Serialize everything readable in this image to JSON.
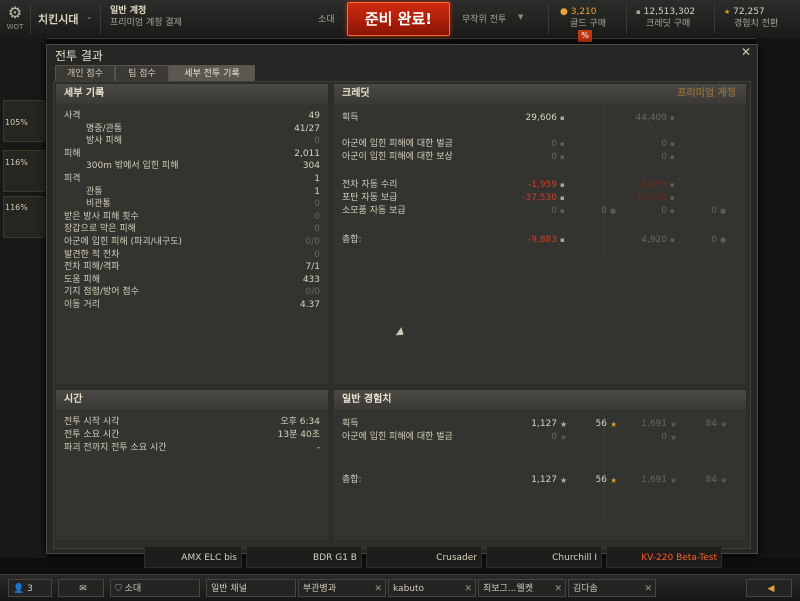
{
  "topbar": {
    "logo_text": "WOT",
    "clan_label": "치킨시대",
    "account_type": "일반 계정",
    "account_sub": "프리미엄 계정 결제",
    "squad_label": "소대",
    "battle_button": "준비 완료!",
    "battle_mode": "무작위 전투",
    "gold_value": "3,210",
    "gold_label": "골드 구매",
    "gold_badge": "%",
    "credits_value": "12,513,302",
    "credits_label": "크레딧 구매",
    "exp_value": "72,257",
    "exp_label": "경험치 전환"
  },
  "side": {
    "c1": "105%",
    "c2": "116%",
    "c3": "116%"
  },
  "window": {
    "title": "전투 결과",
    "close_icon": "close-icon",
    "tabs": [
      "개인 점수",
      "팀 점수",
      "세부 전투 기록"
    ],
    "active_tab": 2
  },
  "details": {
    "header": "세부 기록",
    "rows": [
      {
        "label": "사격",
        "value": "49",
        "dim": false,
        "indent": false
      },
      {
        "label": "명중/관통",
        "value": "41/27",
        "dim": false,
        "indent": true
      },
      {
        "label": "방사 피해",
        "value": "0",
        "dim": true,
        "indent": true
      },
      {
        "label": "피해",
        "value": "2,011",
        "dim": false,
        "indent": false
      },
      {
        "label": "300m 밖에서 입힌 피해",
        "value": "304",
        "dim": false,
        "indent": true
      },
      {
        "label": "피격",
        "value": "1",
        "dim": false,
        "indent": false
      },
      {
        "label": "관통",
        "value": "1",
        "dim": false,
        "indent": true
      },
      {
        "label": "비관통",
        "value": "0",
        "dim": true,
        "indent": true
      },
      {
        "label": "받은 방사 피해 횟수",
        "value": "0",
        "dim": true,
        "indent": false
      },
      {
        "label": "장갑으로 막은 피해",
        "value": "0",
        "dim": true,
        "indent": false
      },
      {
        "label": "아군에 입힌 피해 (파괴/내구도)",
        "value": "0/0",
        "dim": true,
        "indent": false
      },
      {
        "label": "발견한 적 전차",
        "value": "0",
        "dim": true,
        "indent": false
      },
      {
        "label": "전차 피해/격파",
        "value": "7/1",
        "dim": false,
        "indent": false
      },
      {
        "label": "도움 피해",
        "value": "433",
        "dim": false,
        "indent": false
      },
      {
        "label": "기지 점령/방어 점수",
        "value": "0/0",
        "dim": true,
        "indent": false
      },
      {
        "label": "이동 거리",
        "value": "4.37",
        "dim": false,
        "indent": false
      }
    ]
  },
  "credits": {
    "header": "크레딧",
    "premium_header": "프리미엄 계정",
    "earned_label": "획득",
    "earned": "29,606",
    "earned_prem": "44,409",
    "ff_fine_label": "아군에 입힌 피해에 대한 벌금",
    "ff_fine": "0",
    "ff_fine_prem": "0",
    "ff_comp_label": "아군이 입힌 피해에 대한 보상",
    "ff_comp": "0",
    "ff_comp_prem": "0",
    "repair_label": "전차 자동 수리",
    "repair": "-1,959",
    "repair_prem": "-1,959",
    "ammo_label": "포탄 자동 보급",
    "ammo": "-37,530",
    "ammo_prem": "-37,530",
    "consum_label": "소모품 자동 보급",
    "consum": "0",
    "consum_gold": "0",
    "consum_prem": "0",
    "consum_prem_gold": "0",
    "total_label": "총합:",
    "total": "-9,883",
    "total_prem": "4,920",
    "total_prem_gold": "0"
  },
  "time": {
    "header": "시간",
    "rows": [
      {
        "label": "전투 시작 시각",
        "value": "오후 6:34"
      },
      {
        "label": "전투 소요 시간",
        "value": "13분 40초"
      },
      {
        "label": "파괴 전까지 전투 소요 시간",
        "value": "-"
      }
    ]
  },
  "experience": {
    "header": "일반 경험치",
    "earned_label": "획득",
    "earned": "1,127",
    "earned_free": "56",
    "earned_prem": "1,691",
    "earned_prem_free": "84",
    "fine_label": "아군에 입힌 피해에 대한 벌금",
    "fine": "0",
    "fine_prem": "0",
    "total_label": "총합:",
    "total": "1,127",
    "total_free": "56",
    "total_prem": "1,691",
    "total_prem_free": "84"
  },
  "vehicles": [
    "AMX ELC bis",
    "BDR G1 B",
    "Crusader",
    "Churchill I",
    "KV-220 Beta-Test"
  ],
  "bottombar": {
    "friends_count": "3",
    "squad_label": "소대",
    "channels": [
      "일반 채널",
      "부관병과",
      "kabuto",
      "최보그...웰켓",
      "김다솜"
    ]
  }
}
